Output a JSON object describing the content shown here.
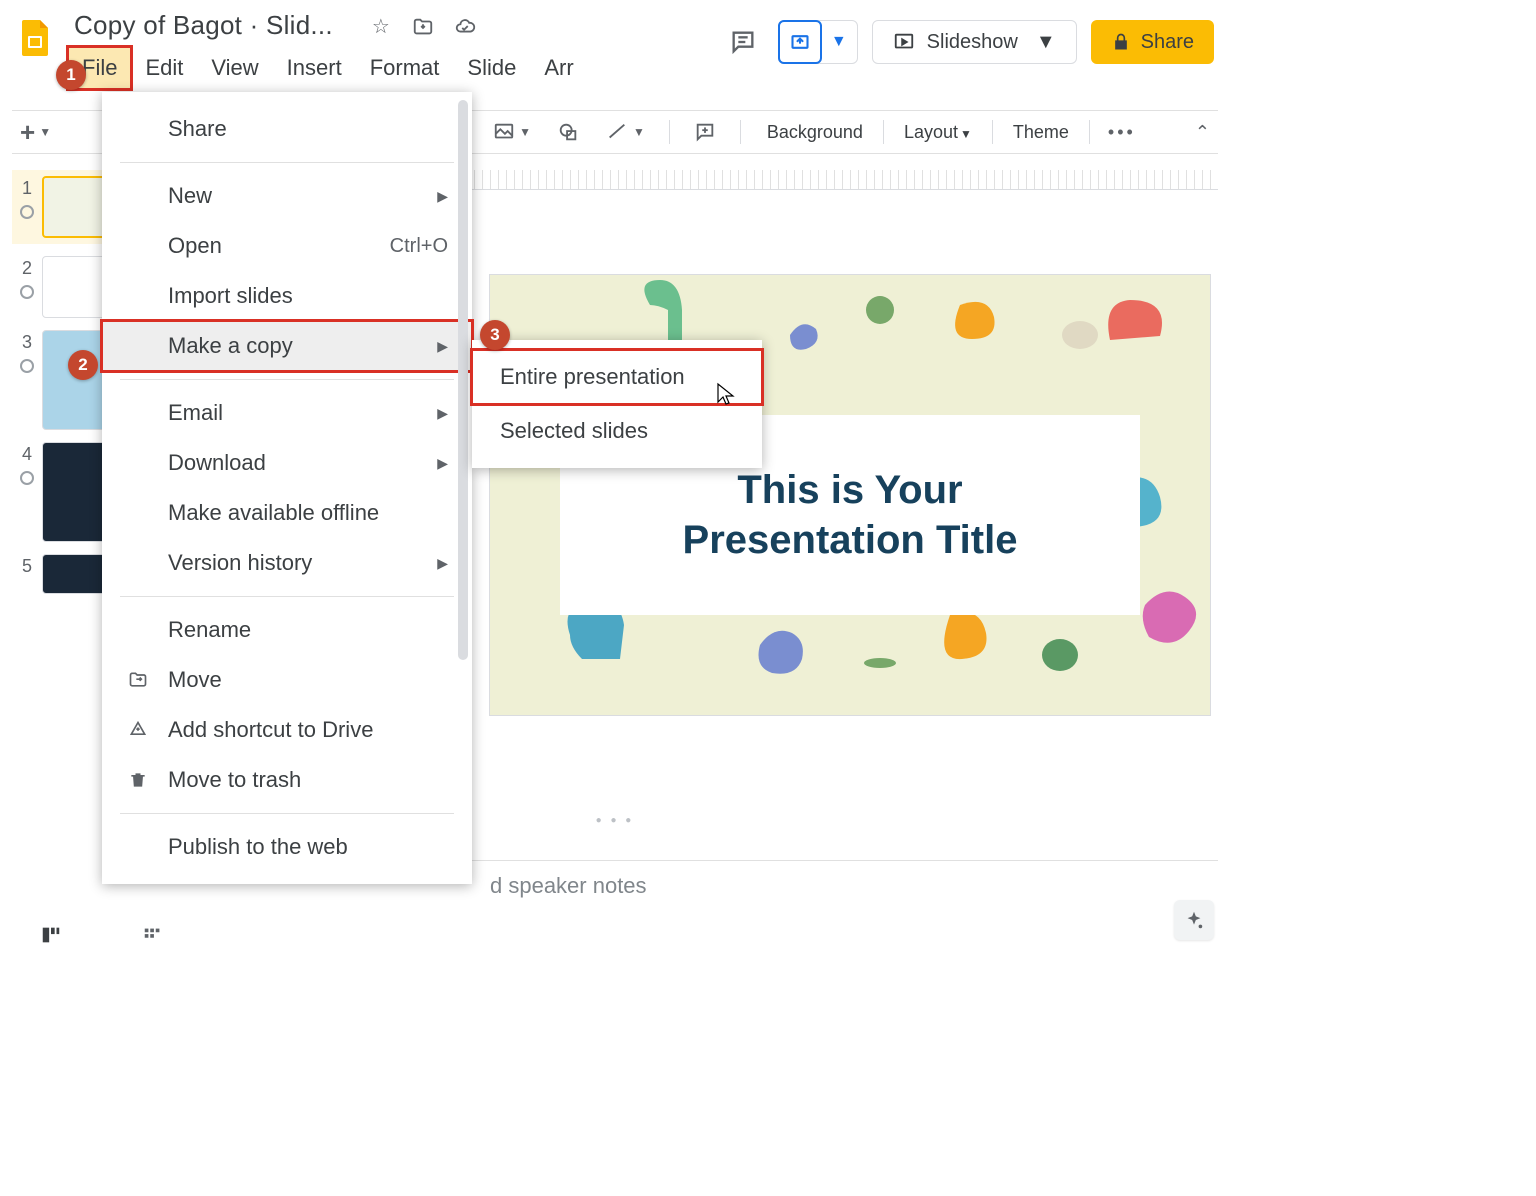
{
  "document": {
    "title": "Copy of Bagot · Slid..."
  },
  "menus": {
    "file": "File",
    "edit": "Edit",
    "view": "View",
    "insert": "Insert",
    "format": "Format",
    "slide": "Slide",
    "arrange": "Arr"
  },
  "header_actions": {
    "slideshow": "Slideshow",
    "share": "Share"
  },
  "toolbar": {
    "background": "Background",
    "layout": "Layout",
    "theme": "Theme"
  },
  "file_menu": {
    "share": "Share",
    "new_": "New",
    "open": "Open",
    "open_shortcut": "Ctrl+O",
    "import": "Import slides",
    "make_copy": "Make a copy",
    "email": "Email",
    "download": "Download",
    "offline": "Make available offline",
    "version": "Version history",
    "rename": "Rename",
    "move": "Move",
    "add_shortcut": "Add shortcut to Drive",
    "trash": "Move to trash",
    "publish": "Publish to the web"
  },
  "submenu": {
    "entire": "Entire presentation",
    "selected": "Selected slides"
  },
  "thumbs": [
    "1",
    "2",
    "3",
    "4",
    "5"
  ],
  "slide": {
    "title_line1": "This is Your",
    "title_line2": "Presentation Title"
  },
  "speaker_notes_placeholder": "d speaker notes",
  "annotations": {
    "b1": "1",
    "b2": "2",
    "b3": "3"
  }
}
